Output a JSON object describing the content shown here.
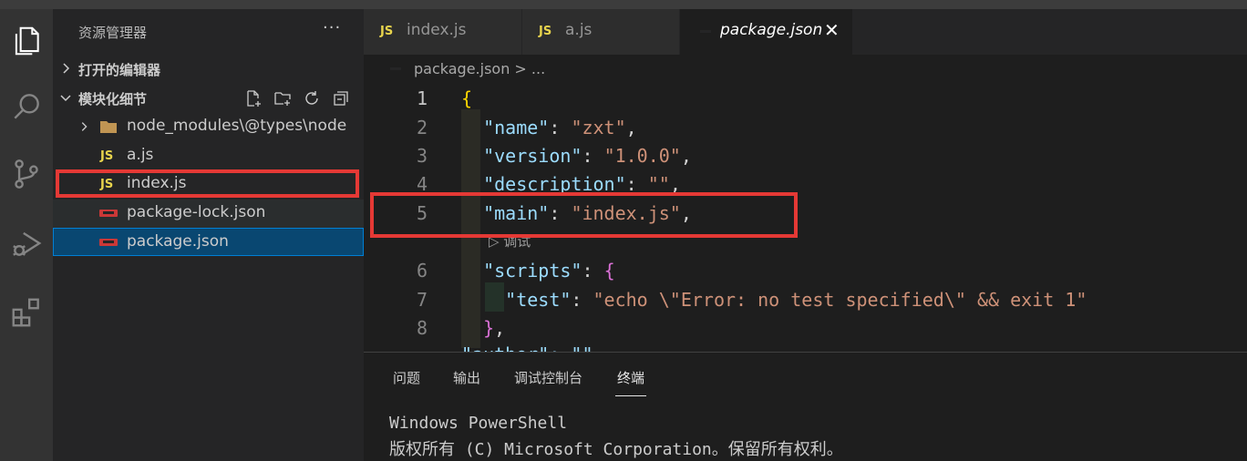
{
  "explorer": {
    "title": "资源管理器",
    "more": "···",
    "open_editors_label": "打开的编辑器",
    "project_label": "模块化细节",
    "tree": [
      {
        "name": "node_modules\\@types\\node",
        "type": "folder"
      },
      {
        "name": "a.js",
        "type": "js",
        "badge": "JS"
      },
      {
        "name": "index.js",
        "type": "js",
        "badge": "JS"
      },
      {
        "name": "package-lock.json",
        "type": "npm"
      },
      {
        "name": "package.json",
        "type": "npm"
      }
    ]
  },
  "tabs": [
    {
      "badge": "JS",
      "label": "index.js"
    },
    {
      "badge": "JS",
      "label": "a.js"
    },
    {
      "label": "package.json",
      "active": true,
      "close": "✕"
    }
  ],
  "breadcrumb": {
    "text": "package.json > ..."
  },
  "editor": {
    "line_numbers": [
      "1",
      "2",
      "3",
      "4",
      "5",
      "6",
      "7",
      "8"
    ],
    "lines": {
      "l1_open": "{",
      "l2_key": "\"name\"",
      "l2_sep": ": ",
      "l2_val": "\"zxt\"",
      "l2_end": ",",
      "l3_key": "\"version\"",
      "l3_sep": ": ",
      "l3_val": "\"1.0.0\"",
      "l3_end": ",",
      "l4_key": "\"description\"",
      "l4_sep": ": ",
      "l4_val": "\"\"",
      "l4_end": ",",
      "l5_key": "\"main\"",
      "l5_sep": ": ",
      "l5_val": "\"index.js\"",
      "l5_end": ",",
      "l6_key": "\"scripts\"",
      "l6_sep": ": ",
      "l6_open": "{",
      "l7_key": "\"test\"",
      "l7_sep": ": ",
      "l7_val": "\"echo \\\"Error: no test specified\\\" && exit 1\"",
      "l8_close": "}",
      "l8_end": ",",
      "l9_partial": "\"author\": \"\""
    },
    "codelens": "▷ 调试"
  },
  "panel": {
    "tabs": [
      "问题",
      "输出",
      "调试控制台",
      "终端"
    ],
    "active_tab": "终端",
    "terminal_lines": [
      "Windows PowerShell",
      "版权所有 (C) Microsoft Corporation。保留所有权利。"
    ]
  },
  "colors": {
    "annotation_red": "#e53935",
    "selection": "#094771",
    "js_yellow": "#e8d44d",
    "npm_red": "#cb3837"
  }
}
